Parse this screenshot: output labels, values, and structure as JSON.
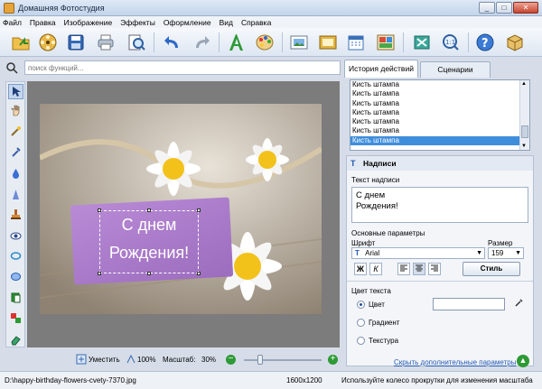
{
  "window": {
    "title": "Домашняя Фотостудия"
  },
  "menu": [
    "Файл",
    "Правка",
    "Изображение",
    "Эффекты",
    "Оформление",
    "Вид",
    "Справка"
  ],
  "search": {
    "placeholder": "поиск функций..."
  },
  "zoombar": {
    "fit_label": "Уместить",
    "hundred_label": "100%",
    "scale_label": "Масштаб:",
    "scale_value": "30%"
  },
  "image_text": {
    "line1": "С днем",
    "line2": "Рождения!"
  },
  "statusbar": {
    "path": "D:\\happy-birthday-flowers-cvety-7370.jpg",
    "size": "1600x1200",
    "hint": "Используйте колесо прокрутки для изменения масштаба"
  },
  "right": {
    "tabs": [
      {
        "label": "История действий"
      },
      {
        "label": "Сценарии"
      }
    ],
    "history": [
      "Кисть штампа",
      "Кисть штампа",
      "Кисть штампа",
      "Кисть штампа",
      "Кисть штампа",
      "Кисть штампа",
      "Кисть штампа"
    ],
    "props": {
      "title": "Надписи",
      "text_label": "Текст надписи",
      "text_line1": "С днем",
      "text_line2": "Рождения!",
      "basic_label": "Основные параметры",
      "font_label": "Шрифт",
      "font_value": "Arial",
      "size_label": "Размер",
      "size_value": "159",
      "bold_glyph": "Ж",
      "italic_glyph": "К",
      "style_button": "Стиль",
      "color_section": "Цвет текста",
      "opt_color": "Цвет",
      "opt_gradient": "Градиент",
      "opt_texture": "Текстура",
      "hide_link": "Скрыть дополнительные параметры"
    }
  },
  "colors": {
    "accent": "#3f8edc",
    "selection": "#3f8edc",
    "tag": "#a878c8"
  }
}
